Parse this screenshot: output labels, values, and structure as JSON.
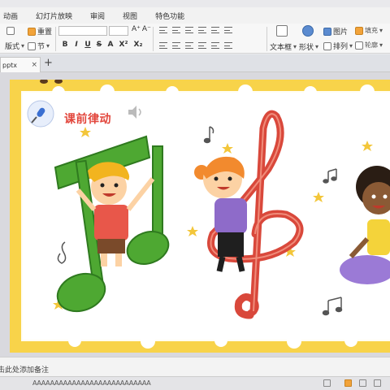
{
  "menubar": {
    "items": [
      "动画",
      "幻灯片放映",
      "审阅",
      "视图",
      "特色功能"
    ]
  },
  "ribbon": {
    "reset_label": "重置",
    "layout_label": "版式",
    "section_label": "节",
    "textbox_label": "文本框",
    "shape_label": "形状",
    "picture_label": "图片",
    "arrange_label": "排列",
    "fill_label": "填充",
    "outline_label": "轮廓",
    "format_buttons": [
      "B",
      "I",
      "U",
      "S",
      "A",
      "X²",
      "X₂"
    ]
  },
  "tabbar": {
    "doc_tab": "pptx",
    "close": "×",
    "new_tab": "+"
  },
  "slide": {
    "title": "课前律动"
  },
  "notes": {
    "placeholder": "单击此处添加备注"
  },
  "statusbar": {
    "text": "AAAAAAAAAAAAAAAAAAAAAAAAAAA"
  },
  "colors": {
    "title_red": "#e2453b",
    "border_yellow": "#f8d34a",
    "note_green": "#4ea832",
    "clef_red": "#d9483b"
  }
}
